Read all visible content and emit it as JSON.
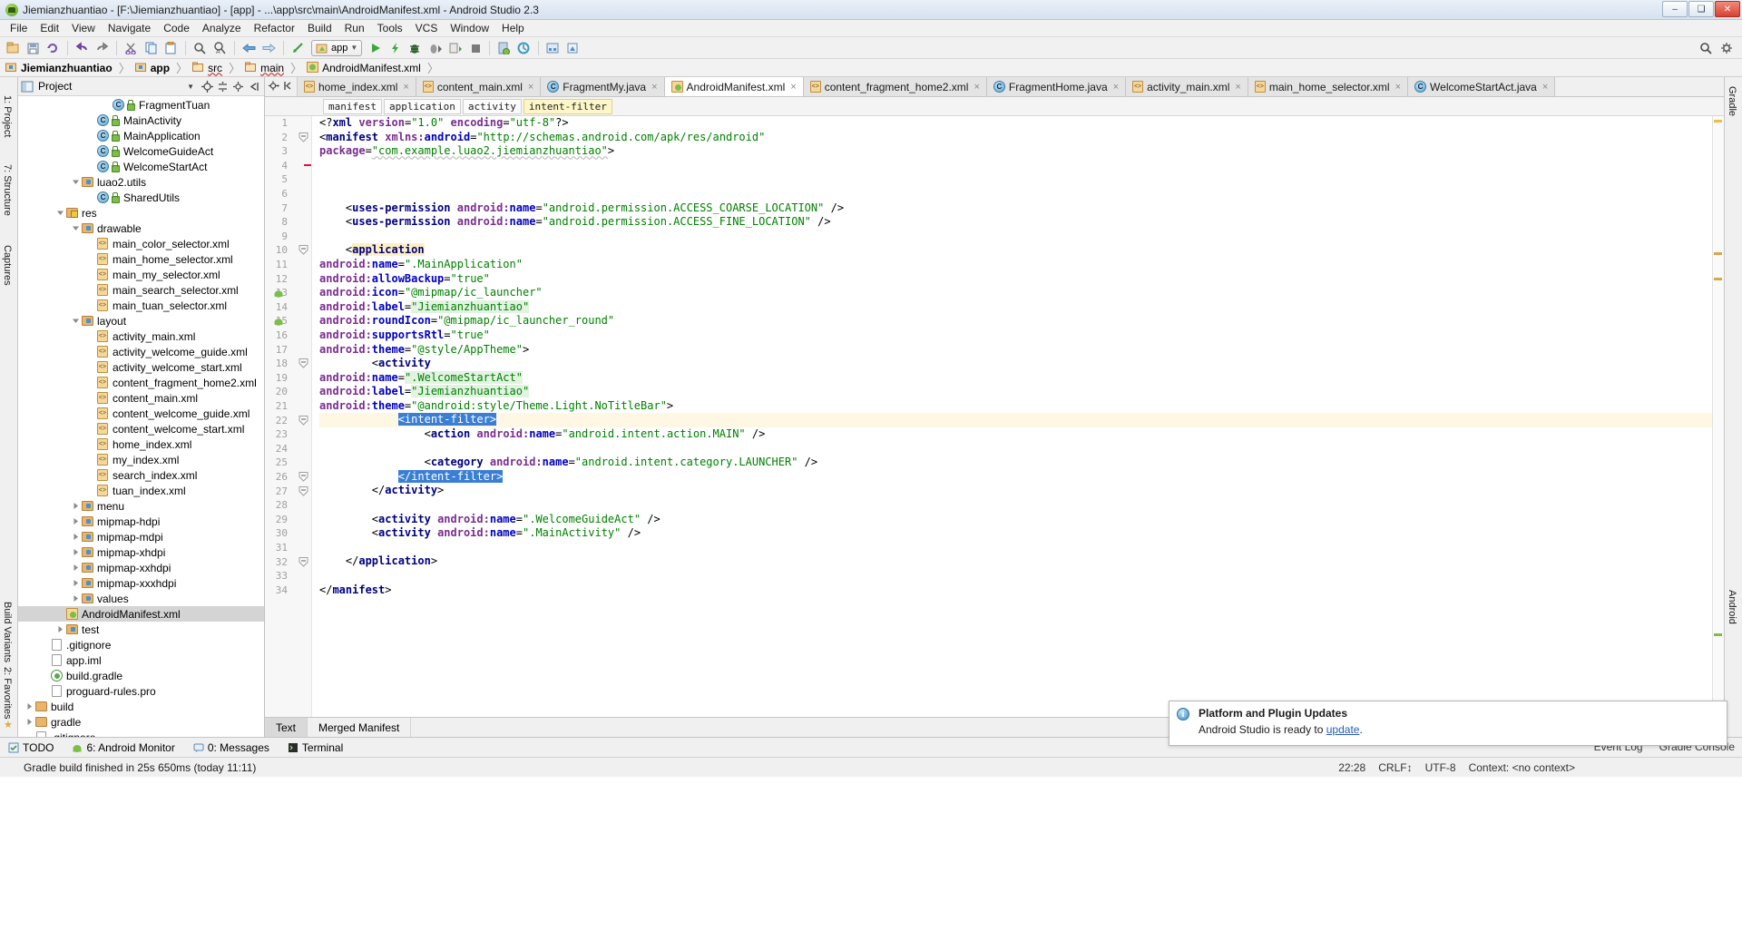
{
  "window": {
    "title": "Jiemianzhuantiao - [F:\\Jiemianzhuantiao] - [app] - ...\\app\\src\\main\\AndroidManifest.xml - Android Studio 2.3",
    "minimize": "–",
    "maximize": "❑",
    "close": "✕"
  },
  "menubar": [
    "File",
    "Edit",
    "View",
    "Navigate",
    "Code",
    "Analyze",
    "Refactor",
    "Build",
    "Run",
    "Tools",
    "VCS",
    "Window",
    "Help"
  ],
  "toolbar": {
    "run_config_label": "app",
    "icons": [
      "open-folder-icon",
      "save-all-icon",
      "sync-icon",
      "undo-icon",
      "redo-icon",
      "cut-icon",
      "copy-icon",
      "paste-icon",
      "find-icon",
      "replace-icon",
      "back-icon",
      "forward-icon",
      "gradle-sync-icon",
      "run-icon",
      "apply-changes-icon",
      "debug-icon",
      "run-coverage-icon",
      "attach-debugger-icon",
      "stop-icon",
      "avd-manager-icon",
      "sdk-manager-icon",
      "project-structure-icon",
      "search-everywhere-icon"
    ]
  },
  "breadcrumb": [
    {
      "label": "Jiemianzhuantiao",
      "icon": "module-icon",
      "bold": true
    },
    {
      "label": "app",
      "icon": "module-icon",
      "bold": true
    },
    {
      "label": "src",
      "icon": "folder-icon",
      "bold": false
    },
    {
      "label": "main",
      "icon": "folder-icon",
      "bold": false
    },
    {
      "label": "AndroidManifest.xml",
      "icon": "manifest-icon",
      "bold": false
    }
  ],
  "left_rail": [
    "1: Project",
    "7: Structure",
    "Captures"
  ],
  "left_rail_bottom": [
    "Build Variants",
    "2: Favorites"
  ],
  "right_rail": [
    "Gradle",
    "Android"
  ],
  "project_panel": {
    "title": "Project",
    "header_icons": [
      "project-view-icon",
      "dropdown-icon",
      "locate-icon",
      "collapse-all-icon",
      "settings-icon",
      "hide-icon"
    ],
    "tree": [
      {
        "indent": 5,
        "arrow": "",
        "icon": "class-icon",
        "label": "FragmentTuan",
        "selected": false
      },
      {
        "indent": 4,
        "arrow": "",
        "icon": "class-icon",
        "label": "MainActivity",
        "selected": false
      },
      {
        "indent": 4,
        "arrow": "",
        "icon": "class-icon",
        "label": "MainApplication",
        "selected": false
      },
      {
        "indent": 4,
        "arrow": "",
        "icon": "class-icon",
        "label": "WelcomeGuideAct",
        "selected": false
      },
      {
        "indent": 4,
        "arrow": "",
        "icon": "class-icon",
        "label": "WelcomeStartAct",
        "selected": false
      },
      {
        "indent": 3,
        "arrow": "down",
        "icon": "package-icon",
        "label": "luao2.utils",
        "selected": false
      },
      {
        "indent": 4,
        "arrow": "",
        "icon": "class-icon",
        "label": "SharedUtils",
        "selected": false
      },
      {
        "indent": 2,
        "arrow": "down",
        "icon": "res-icon",
        "label": "res",
        "selected": false
      },
      {
        "indent": 3,
        "arrow": "down",
        "icon": "package-icon",
        "label": "drawable",
        "selected": false
      },
      {
        "indent": 4,
        "arrow": "",
        "icon": "xml-icon",
        "label": "main_color_selector.xml",
        "selected": false
      },
      {
        "indent": 4,
        "arrow": "",
        "icon": "xml-icon",
        "label": "main_home_selector.xml",
        "selected": false
      },
      {
        "indent": 4,
        "arrow": "",
        "icon": "xml-icon",
        "label": "main_my_selector.xml",
        "selected": false
      },
      {
        "indent": 4,
        "arrow": "",
        "icon": "xml-icon",
        "label": "main_search_selector.xml",
        "selected": false
      },
      {
        "indent": 4,
        "arrow": "",
        "icon": "xml-icon",
        "label": "main_tuan_selector.xml",
        "selected": false
      },
      {
        "indent": 3,
        "arrow": "down",
        "icon": "package-icon",
        "label": "layout",
        "selected": false
      },
      {
        "indent": 4,
        "arrow": "",
        "icon": "xml-icon",
        "label": "activity_main.xml",
        "selected": false
      },
      {
        "indent": 4,
        "arrow": "",
        "icon": "xml-icon",
        "label": "activity_welcome_guide.xml",
        "selected": false
      },
      {
        "indent": 4,
        "arrow": "",
        "icon": "xml-icon",
        "label": "activity_welcome_start.xml",
        "selected": false
      },
      {
        "indent": 4,
        "arrow": "",
        "icon": "xml-icon",
        "label": "content_fragment_home2.xml",
        "selected": false
      },
      {
        "indent": 4,
        "arrow": "",
        "icon": "xml-icon",
        "label": "content_main.xml",
        "selected": false
      },
      {
        "indent": 4,
        "arrow": "",
        "icon": "xml-icon",
        "label": "content_welcome_guide.xml",
        "selected": false
      },
      {
        "indent": 4,
        "arrow": "",
        "icon": "xml-icon",
        "label": "content_welcome_start.xml",
        "selected": false
      },
      {
        "indent": 4,
        "arrow": "",
        "icon": "xml-icon",
        "label": "home_index.xml",
        "selected": false
      },
      {
        "indent": 4,
        "arrow": "",
        "icon": "xml-icon",
        "label": "my_index.xml",
        "selected": false
      },
      {
        "indent": 4,
        "arrow": "",
        "icon": "xml-icon",
        "label": "search_index.xml",
        "selected": false
      },
      {
        "indent": 4,
        "arrow": "",
        "icon": "xml-icon",
        "label": "tuan_index.xml",
        "selected": false
      },
      {
        "indent": 3,
        "arrow": "right",
        "icon": "package-icon",
        "label": "menu",
        "selected": false
      },
      {
        "indent": 3,
        "arrow": "right",
        "icon": "package-icon",
        "label": "mipmap-hdpi",
        "selected": false
      },
      {
        "indent": 3,
        "arrow": "right",
        "icon": "package-icon",
        "label": "mipmap-mdpi",
        "selected": false
      },
      {
        "indent": 3,
        "arrow": "right",
        "icon": "package-icon",
        "label": "mipmap-xhdpi",
        "selected": false
      },
      {
        "indent": 3,
        "arrow": "right",
        "icon": "package-icon",
        "label": "mipmap-xxhdpi",
        "selected": false
      },
      {
        "indent": 3,
        "arrow": "right",
        "icon": "package-icon",
        "label": "mipmap-xxxhdpi",
        "selected": false
      },
      {
        "indent": 3,
        "arrow": "right",
        "icon": "package-icon",
        "label": "values",
        "selected": false
      },
      {
        "indent": 2,
        "arrow": "",
        "icon": "manifest-icon",
        "label": "AndroidManifest.xml",
        "selected": true
      },
      {
        "indent": 2,
        "arrow": "right",
        "icon": "package-icon",
        "label": "test",
        "selected": false
      },
      {
        "indent": 1,
        "arrow": "",
        "icon": "file-icon",
        "label": ".gitignore",
        "selected": false
      },
      {
        "indent": 1,
        "arrow": "",
        "icon": "file-icon",
        "label": "app.iml",
        "selected": false
      },
      {
        "indent": 1,
        "arrow": "",
        "icon": "gradle-icon",
        "label": "build.gradle",
        "selected": false
      },
      {
        "indent": 1,
        "arrow": "",
        "icon": "file-icon",
        "label": "proguard-rules.pro",
        "selected": false
      },
      {
        "indent": 0,
        "arrow": "right",
        "icon": "folder-icon",
        "label": "build",
        "selected": false
      },
      {
        "indent": 0,
        "arrow": "right",
        "icon": "folder-icon",
        "label": "gradle",
        "selected": false
      },
      {
        "indent": 0,
        "arrow": "",
        "icon": "file-icon",
        "label": ".gitignore",
        "selected": false
      }
    ]
  },
  "editor": {
    "tabs": [
      {
        "label": "home_index.xml",
        "icon": "xml-icon",
        "active": false
      },
      {
        "label": "content_main.xml",
        "icon": "xml-icon",
        "active": false
      },
      {
        "label": "FragmentMy.java",
        "icon": "class-icon",
        "active": false
      },
      {
        "label": "AndroidManifest.xml",
        "icon": "manifest-icon",
        "active": true
      },
      {
        "label": "content_fragment_home2.xml",
        "icon": "xml-icon",
        "active": false
      },
      {
        "label": "FragmentHome.java",
        "icon": "class-icon",
        "active": false
      },
      {
        "label": "activity_main.xml",
        "icon": "xml-icon",
        "active": false
      },
      {
        "label": "main_home_selector.xml",
        "icon": "xml-icon",
        "active": false
      },
      {
        "label": "WelcomeStartAct.java",
        "icon": "class-icon",
        "active": false
      }
    ],
    "tab_close": "×",
    "structure_breadcrumb": [
      {
        "label": "manifest",
        "highlighted": false
      },
      {
        "label": "application",
        "highlighted": false
      },
      {
        "label": "activity",
        "highlighted": false
      },
      {
        "label": "intent-filter",
        "highlighted": true
      }
    ],
    "bottom_tabs": [
      {
        "label": "Text",
        "active": true
      },
      {
        "label": "Merged Manifest",
        "active": false
      }
    ],
    "line_count": 34,
    "lines": [
      {
        "n": 1,
        "text": "<?xml version=\"1.0\" encoding=\"utf-8\"?>"
      },
      {
        "n": 2,
        "text": "<manifest xmlns:android=\"http://schemas.android.com/apk/res/android\""
      },
      {
        "n": 3,
        "text": "    package=\"com.example.luao2.jiemianzhuantiao\">"
      },
      {
        "n": 4,
        "text": ""
      },
      {
        "n": 5,
        "text": ""
      },
      {
        "n": 6,
        "text": ""
      },
      {
        "n": 7,
        "text": "    <uses-permission android:name=\"android.permission.ACCESS_COARSE_LOCATION\" />"
      },
      {
        "n": 8,
        "text": "    <uses-permission android:name=\"android.permission.ACCESS_FINE_LOCATION\" />"
      },
      {
        "n": 9,
        "text": ""
      },
      {
        "n": 10,
        "text": "    <application"
      },
      {
        "n": 11,
        "text": "        android:name=\".MainApplication\""
      },
      {
        "n": 12,
        "text": "        android:allowBackup=\"true\""
      },
      {
        "n": 13,
        "text": "        android:icon=\"@mipmap/ic_launcher\""
      },
      {
        "n": 14,
        "text": "        android:label=\"Jiemianzhuantiao\""
      },
      {
        "n": 15,
        "text": "        android:roundIcon=\"@mipmap/ic_launcher_round\""
      },
      {
        "n": 16,
        "text": "        android:supportsRtl=\"true\""
      },
      {
        "n": 17,
        "text": "        android:theme=\"@style/AppTheme\">"
      },
      {
        "n": 18,
        "text": "        <activity"
      },
      {
        "n": 19,
        "text": "            android:name=\".WelcomeStartAct\""
      },
      {
        "n": 20,
        "text": "            android:label=\"Jiemianzhuantiao\""
      },
      {
        "n": 21,
        "text": "            android:theme=\"@android:style/Theme.Light.NoTitleBar\">"
      },
      {
        "n": 22,
        "text": "            <intent-filter>"
      },
      {
        "n": 23,
        "text": "                <action android:name=\"android.intent.action.MAIN\" />"
      },
      {
        "n": 24,
        "text": ""
      },
      {
        "n": 25,
        "text": "                <category android:name=\"android.intent.category.LAUNCHER\" />"
      },
      {
        "n": 26,
        "text": "            </intent-filter>"
      },
      {
        "n": 27,
        "text": "        </activity>"
      },
      {
        "n": 28,
        "text": ""
      },
      {
        "n": 29,
        "text": "        <activity android:name=\".WelcomeGuideAct\" />"
      },
      {
        "n": 30,
        "text": "        <activity android:name=\".MainActivity\" />"
      },
      {
        "n": 31,
        "text": ""
      },
      {
        "n": 32,
        "text": "    </application>"
      },
      {
        "n": 33,
        "text": ""
      },
      {
        "n": 34,
        "text": "</manifest>"
      }
    ]
  },
  "bottom_tool_buttons": [
    {
      "label": "TODO",
      "icon": "todo-icon"
    },
    {
      "label": "6: Android Monitor",
      "icon": "android-icon"
    },
    {
      "label": "0: Messages",
      "icon": "messages-icon"
    },
    {
      "label": "Terminal",
      "icon": "terminal-icon"
    }
  ],
  "statusbar": {
    "message": "Gradle build finished in 25s 650ms (today 11:11)",
    "time": "22:28",
    "line_sep": "CRLF↕",
    "encoding": "UTF-8",
    "context": "Context: <no context>",
    "event_log": "Event Log",
    "gradle_console": "Gradle Console"
  },
  "notification": {
    "title": "Platform and Plugin Updates",
    "body_prefix": "Android Studio is ready to ",
    "link": "update",
    "body_suffix": "."
  },
  "colors": {
    "accent_blue": "#3a7fd5",
    "tag": "#000080",
    "attr": "#7a2d8f",
    "value": "#008000",
    "ns": "#0000c0",
    "highlight_yellow": "#fdf0c0",
    "highlight_green": "#e2f3e2",
    "selection_blue": "#3a7fd5"
  }
}
